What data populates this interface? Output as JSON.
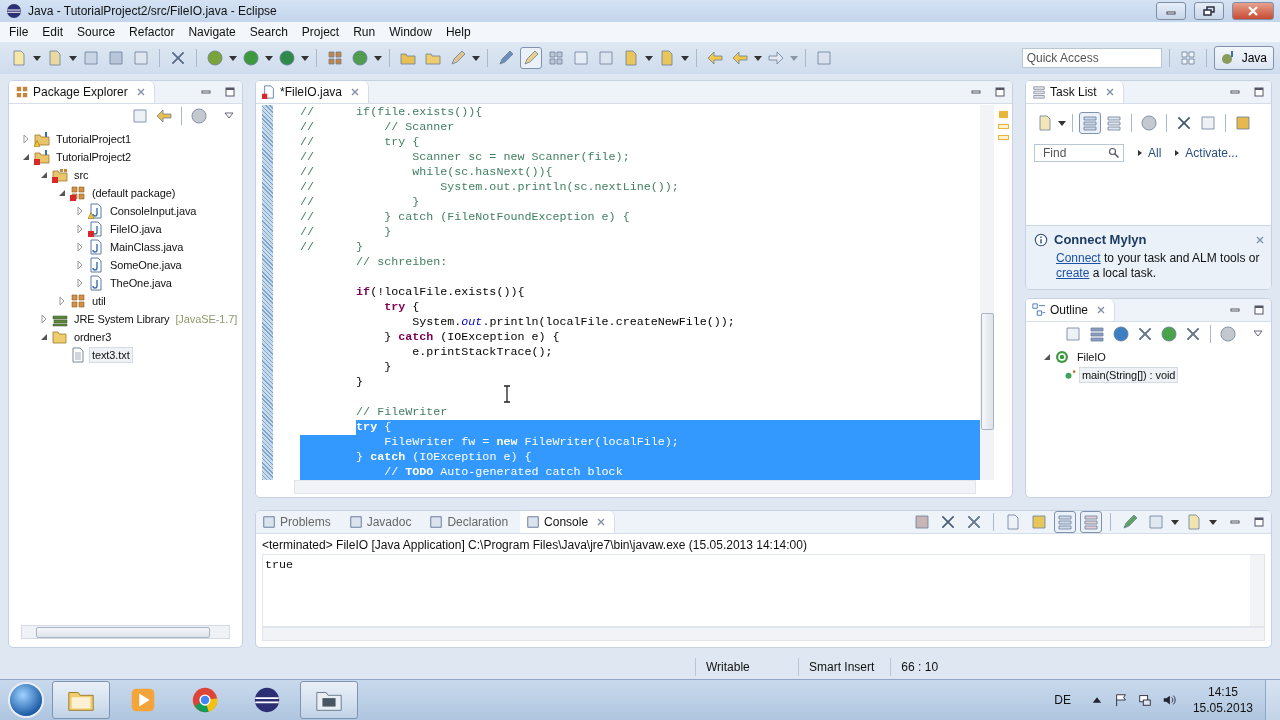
{
  "window": {
    "title": "Java - TutorialProject2/src/FileIO.java - Eclipse"
  },
  "menu": [
    "File",
    "Edit",
    "Source",
    "Refactor",
    "Navigate",
    "Search",
    "Project",
    "Run",
    "Window",
    "Help"
  ],
  "quick_access": {
    "placeholder": "Quick Access"
  },
  "perspectives": [
    {
      "label": "Java",
      "selected": true
    }
  ],
  "explorer": {
    "title": "Package Explorer",
    "tree": [
      {
        "label": "TutorialProject1",
        "kind": "project",
        "error": false,
        "warning": true,
        "expanded": false,
        "selected": false
      },
      {
        "label": "TutorialProject2",
        "kind": "project",
        "error": true,
        "warning": false,
        "expanded": true,
        "selected": false,
        "children": [
          {
            "label": "src",
            "kind": "source-folder",
            "error": true,
            "warning": false,
            "expanded": true,
            "selected": false,
            "children": [
              {
                "label": "(default package)",
                "kind": "package",
                "error": true,
                "warning": false,
                "expanded": true,
                "selected": false,
                "children": [
                  {
                    "label": "ConsoleInput.java",
                    "kind": "java",
                    "error": false,
                    "warning": true,
                    "expanded": false,
                    "selected": false
                  },
                  {
                    "label": "FileIO.java",
                    "kind": "java",
                    "error": true,
                    "warning": false,
                    "expanded": false,
                    "selected": false
                  },
                  {
                    "label": "MainClass.java",
                    "kind": "java",
                    "error": false,
                    "warning": false,
                    "expanded": false,
                    "selected": false
                  },
                  {
                    "label": "SomeOne.java",
                    "kind": "java",
                    "error": false,
                    "warning": false,
                    "expanded": false,
                    "selected": false
                  },
                  {
                    "label": "TheOne.java",
                    "kind": "java",
                    "error": false,
                    "warning": false,
                    "expanded": false,
                    "selected": false
                  }
                ]
              },
              {
                "label": "util",
                "kind": "package",
                "error": false,
                "warning": false,
                "expanded": false,
                "selected": false
              }
            ]
          },
          {
            "label": "JRE System Library",
            "decoration": "[JavaSE-1.7]",
            "kind": "library",
            "error": false,
            "warning": false,
            "expanded": false,
            "selected": false
          },
          {
            "label": "ordner3",
            "kind": "folder",
            "error": false,
            "warning": false,
            "expanded": true,
            "selected": false,
            "children": [
              {
                "label": "text3.txt",
                "kind": "file",
                "error": false,
                "warning": false,
                "selected": true
              }
            ]
          }
        ]
      }
    ]
  },
  "editor": {
    "tab": {
      "label": "*FileIO.java",
      "selected": true
    },
    "lines": [
      {
        "kind": "comment",
        "text": "//      if(file.exists()){",
        "selected": false
      },
      {
        "kind": "comment",
        "text": "//          // Scanner",
        "selected": false
      },
      {
        "kind": "comment",
        "text": "//          try {",
        "selected": false
      },
      {
        "kind": "comment",
        "text": "//              Scanner sc = new Scanner(file);",
        "selected": false
      },
      {
        "kind": "comment",
        "text": "//              while(sc.hasNext()){",
        "selected": false
      },
      {
        "kind": "comment",
        "text": "//                  System.out.println(sc.nextLine());",
        "selected": false
      },
      {
        "kind": "comment",
        "text": "//              }",
        "selected": false
      },
      {
        "kind": "comment",
        "text": "//          } catch (FileNotFoundException e) {",
        "selected": false
      },
      {
        "kind": "comment",
        "text": "//          }",
        "selected": false
      },
      {
        "kind": "comment",
        "text": "//      }",
        "selected": false
      },
      {
        "kind": "comment",
        "text": "        // schreiben:",
        "selected": false
      },
      {
        "kind": "blank",
        "selected": false
      },
      {
        "kind": "code",
        "text": "        **if**(!localFile.exists()){",
        "selected": false
      },
      {
        "kind": "code",
        "text": "            **try** {",
        "selected": false
      },
      {
        "kind": "code",
        "text": "                System.*out*.println(localFile.createNewFile());",
        "selected": false
      },
      {
        "kind": "code",
        "text": "            } **catch** (IOException e) {",
        "selected": false
      },
      {
        "kind": "code",
        "text": "                e.printStackTrace();",
        "selected": false
      },
      {
        "kind": "code",
        "text": "            }",
        "selected": false
      },
      {
        "kind": "code",
        "text": "        }",
        "selected": false
      },
      {
        "kind": "blank",
        "selected": false
      },
      {
        "kind": "comment",
        "text": "        // FileWriter",
        "selected": false
      },
      {
        "kind": "code",
        "text": "        **try** {",
        "selected": true
      },
      {
        "kind": "code",
        "text": "            FileWriter fw = **new** FileWriter(localFile);",
        "selected": true
      },
      {
        "kind": "code",
        "text": "        } **catch** (IOException e) {",
        "selected": true
      },
      {
        "kind": "comment",
        "text": "            // **TODO** Auto-generated catch block",
        "selected": true
      }
    ]
  },
  "task_list": {
    "title": "Task List",
    "find": {
      "placeholder": "Find"
    },
    "filters": [
      "All",
      "Activate..."
    ]
  },
  "mylyn": {
    "title": "Connect Mylyn",
    "parts": [
      {
        "kind": "link",
        "text": "Connect"
      },
      {
        "kind": "text",
        "text": " to your task and ALM tools or "
      },
      {
        "kind": "link",
        "text": "create"
      },
      {
        "kind": "text",
        "text": " a local task."
      }
    ]
  },
  "outline": {
    "title": "Outline",
    "tree": [
      {
        "label": "FileIO",
        "kind": "class",
        "expanded": true,
        "selected": false,
        "children": [
          {
            "label": "main(String[]) : void",
            "kind": "method",
            "selected": true
          }
        ]
      }
    ]
  },
  "bottom": {
    "tabs": [
      {
        "label": "Problems",
        "selected": false
      },
      {
        "label": "Javadoc",
        "selected": false
      },
      {
        "label": "Declaration",
        "selected": false
      },
      {
        "label": "Console",
        "selected": true
      }
    ],
    "console": {
      "header": "<terminated> FileIO [Java Application] C:\\Program Files\\Java\\jre7\\bin\\javaw.exe (15.05.2013 14:14:00)",
      "output": "true"
    }
  },
  "status_bar": [
    "Writable",
    "Smart Insert",
    "66 : 10"
  ],
  "taskbar": {
    "apps": [
      {
        "kind": "explorer",
        "running": true
      },
      {
        "kind": "media",
        "running": false
      },
      {
        "kind": "browser",
        "running": false
      },
      {
        "kind": "eclipse",
        "running": false
      },
      {
        "kind": "video",
        "running": true
      }
    ],
    "language": "DE",
    "time": "14:15",
    "date": "15.05.2013"
  }
}
